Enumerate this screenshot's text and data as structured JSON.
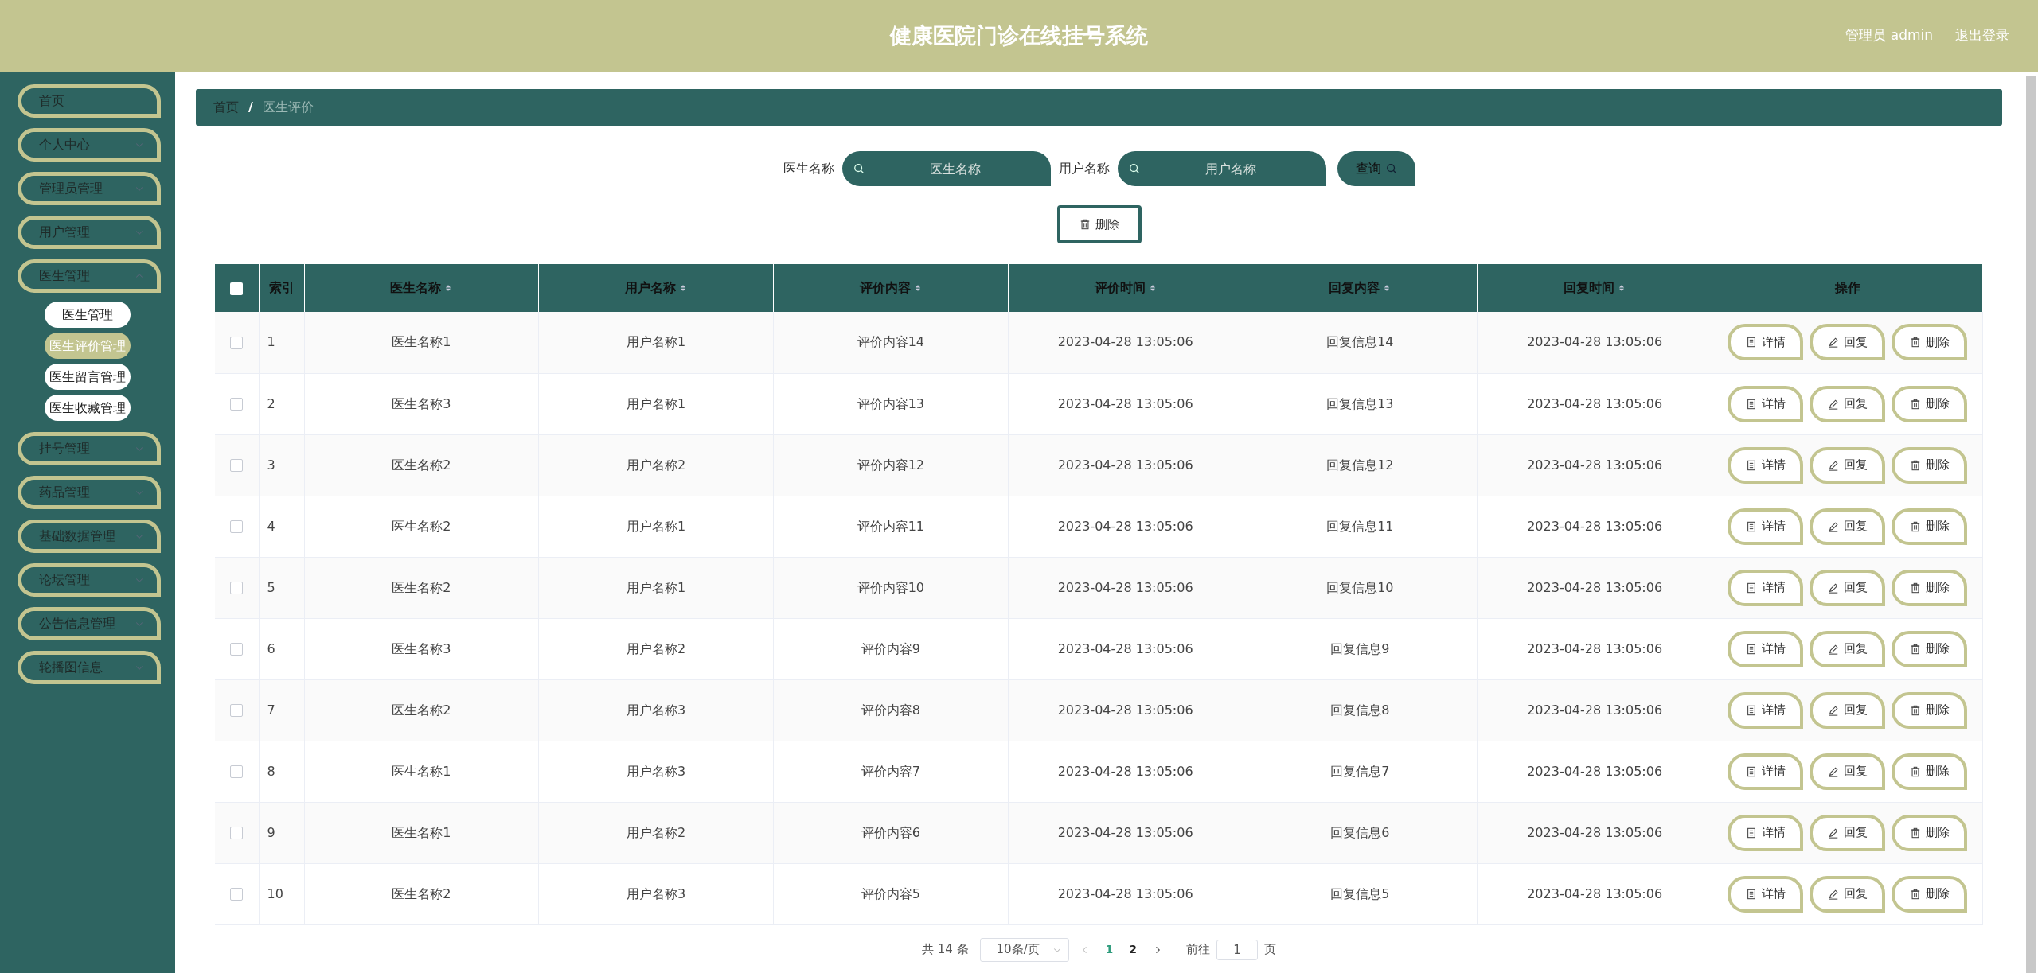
{
  "header": {
    "title": "健康医院门诊在线挂号系统",
    "user": "管理员 admin",
    "logout": "退出登录"
  },
  "sidebar": {
    "items": [
      {
        "label": "首页",
        "kind": "link"
      },
      {
        "label": "个人中心",
        "kind": "menu",
        "expanded": false
      },
      {
        "label": "管理员管理",
        "kind": "menu",
        "expanded": false
      },
      {
        "label": "用户管理",
        "kind": "menu",
        "expanded": false
      },
      {
        "label": "医生管理",
        "kind": "menu",
        "expanded": true,
        "children": [
          {
            "label": "医生管理",
            "selected": false
          },
          {
            "label": "医生评价管理",
            "selected": true
          },
          {
            "label": "医生留言管理",
            "selected": false
          },
          {
            "label": "医生收藏管理",
            "selected": false
          }
        ]
      },
      {
        "label": "挂号管理",
        "kind": "menu",
        "expanded": false
      },
      {
        "label": "药品管理",
        "kind": "menu",
        "expanded": false
      },
      {
        "label": "基础数据管理",
        "kind": "menu",
        "expanded": false
      },
      {
        "label": "论坛管理",
        "kind": "menu",
        "expanded": false
      },
      {
        "label": "公告信息管理",
        "kind": "menu",
        "expanded": false
      },
      {
        "label": "轮播图信息",
        "kind": "menu",
        "expanded": false
      }
    ]
  },
  "breadcrumb": {
    "items": [
      "首页",
      "医生评价"
    ],
    "separator": "/"
  },
  "search": {
    "fields": [
      {
        "label": "医生名称",
        "placeholder": "医生名称"
      },
      {
        "label": "用户名称",
        "placeholder": "用户名称"
      }
    ],
    "button": "查询"
  },
  "delete_button": "删除",
  "table": {
    "all_checked": false,
    "columns": [
      {
        "label": "索引",
        "sortable": false
      },
      {
        "label": "医生名称",
        "sortable": true
      },
      {
        "label": "用户名称",
        "sortable": true
      },
      {
        "label": "评价内容",
        "sortable": true
      },
      {
        "label": "评价时间",
        "sortable": true
      },
      {
        "label": "回复内容",
        "sortable": true
      },
      {
        "label": "回复时间",
        "sortable": true
      },
      {
        "label": "操作",
        "sortable": false
      }
    ],
    "rows": [
      {
        "checked": false,
        "cells": [
          "1",
          "医生名称1",
          "用户名称1",
          "评价内容14",
          "2023-04-28 13:05:06",
          "回复信息14",
          "2023-04-28 13:05:06"
        ],
        "actions": [
          "详情",
          "回复",
          "删除"
        ]
      },
      {
        "checked": false,
        "cells": [
          "2",
          "医生名称3",
          "用户名称1",
          "评价内容13",
          "2023-04-28 13:05:06",
          "回复信息13",
          "2023-04-28 13:05:06"
        ],
        "actions": [
          "详情",
          "回复",
          "删除"
        ]
      },
      {
        "checked": false,
        "cells": [
          "3",
          "医生名称2",
          "用户名称2",
          "评价内容12",
          "2023-04-28 13:05:06",
          "回复信息12",
          "2023-04-28 13:05:06"
        ],
        "actions": [
          "详情",
          "回复",
          "删除"
        ]
      },
      {
        "checked": false,
        "cells": [
          "4",
          "医生名称2",
          "用户名称1",
          "评价内容11",
          "2023-04-28 13:05:06",
          "回复信息11",
          "2023-04-28 13:05:06"
        ],
        "actions": [
          "详情",
          "回复",
          "删除"
        ]
      },
      {
        "checked": false,
        "cells": [
          "5",
          "医生名称2",
          "用户名称1",
          "评价内容10",
          "2023-04-28 13:05:06",
          "回复信息10",
          "2023-04-28 13:05:06"
        ],
        "actions": [
          "详情",
          "回复",
          "删除"
        ]
      },
      {
        "checked": false,
        "cells": [
          "6",
          "医生名称3",
          "用户名称2",
          "评价内容9",
          "2023-04-28 13:05:06",
          "回复信息9",
          "2023-04-28 13:05:06"
        ],
        "actions": [
          "详情",
          "回复",
          "删除"
        ]
      },
      {
        "checked": false,
        "cells": [
          "7",
          "医生名称2",
          "用户名称3",
          "评价内容8",
          "2023-04-28 13:05:06",
          "回复信息8",
          "2023-04-28 13:05:06"
        ],
        "actions": [
          "详情",
          "回复",
          "删除"
        ]
      },
      {
        "checked": false,
        "cells": [
          "8",
          "医生名称1",
          "用户名称3",
          "评价内容7",
          "2023-04-28 13:05:06",
          "回复信息7",
          "2023-04-28 13:05:06"
        ],
        "actions": [
          "详情",
          "回复",
          "删除"
        ]
      },
      {
        "checked": false,
        "cells": [
          "9",
          "医生名称1",
          "用户名称2",
          "评价内容6",
          "2023-04-28 13:05:06",
          "回复信息6",
          "2023-04-28 13:05:06"
        ],
        "actions": [
          "详情",
          "回复",
          "删除"
        ]
      },
      {
        "checked": false,
        "cells": [
          "10",
          "医生名称2",
          "用户名称3",
          "评价内容5",
          "2023-04-28 13:05:06",
          "回复信息5",
          "2023-04-28 13:05:06"
        ],
        "actions": [
          "详情",
          "回复",
          "删除"
        ]
      }
    ]
  },
  "pagination": {
    "total": "共 14 条",
    "page_size": "10条/页",
    "pages": [
      {
        "label": "1",
        "selected": true
      },
      {
        "label": "2",
        "selected": false
      }
    ],
    "goto_label": "前往",
    "goto_value": "1",
    "goto_suffix": "页"
  }
}
